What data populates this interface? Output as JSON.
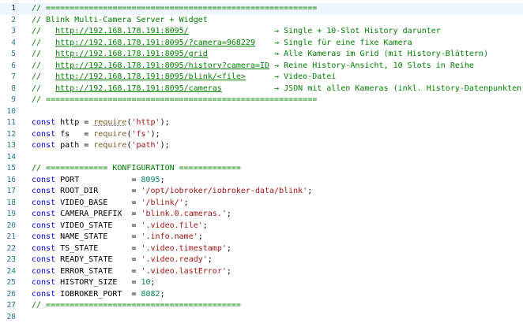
{
  "lines": [
    {
      "n": "1",
      "active": true,
      "tokens": [
        {
          "t": "// =========================================================",
          "c": "c"
        }
      ]
    },
    {
      "n": "2",
      "tokens": [
        {
          "t": "// Blink Multi-Camera Server + Widget",
          "c": "c"
        }
      ]
    },
    {
      "n": "3",
      "tokens": [
        {
          "t": "//   ",
          "c": "c"
        },
        {
          "t": "http://192.168.178.191:8095/",
          "c": "u"
        },
        {
          "t": "                  → Single + 10-Slot History darunter",
          "c": "c"
        }
      ]
    },
    {
      "n": "4",
      "tokens": [
        {
          "t": "//   ",
          "c": "c"
        },
        {
          "t": "http://192.168.178.191:8095/?camera=968229",
          "c": "u"
        },
        {
          "t": "    → Single für eine fixe Kamera",
          "c": "c"
        }
      ]
    },
    {
      "n": "5",
      "tokens": [
        {
          "t": "//   ",
          "c": "c"
        },
        {
          "t": "http://192.168.178.191:8095/grid",
          "c": "u"
        },
        {
          "t": "              → Alle Kameras im Grid (mit History-Blättern)",
          "c": "c"
        }
      ]
    },
    {
      "n": "6",
      "tokens": [
        {
          "t": "//   ",
          "c": "c"
        },
        {
          "t": "http://192.168.178.191:8095/history?camera=ID",
          "c": "u"
        },
        {
          "t": " → Reine History-Ansicht, 10 Slots in Reihe",
          "c": "c"
        }
      ]
    },
    {
      "n": "7",
      "tokens": [
        {
          "t": "//   ",
          "c": "c"
        },
        {
          "t": "http://192.168.178.191:8095/blink/<file>",
          "c": "u"
        },
        {
          "t": "      → Video-Datei",
          "c": "c"
        }
      ]
    },
    {
      "n": "8",
      "tokens": [
        {
          "t": "//   ",
          "c": "c"
        },
        {
          "t": "http://192.168.178.191:8095/cameras",
          "c": "u"
        },
        {
          "t": "           → JSON mit allen Kameras (inkl. History-Datenpunkten)",
          "c": "c"
        }
      ]
    },
    {
      "n": "9",
      "tokens": [
        {
          "t": "// =========================================================",
          "c": "c"
        }
      ]
    },
    {
      "n": "10",
      "tokens": []
    },
    {
      "n": "11",
      "tokens": [
        {
          "t": "const",
          "c": "k"
        },
        {
          "t": " http = ",
          "c": "t"
        },
        {
          "t": "require",
          "c": "f rq"
        },
        {
          "t": "(",
          "c": "t"
        },
        {
          "t": "'http'",
          "c": "s"
        },
        {
          "t": ");",
          "c": "t"
        }
      ]
    },
    {
      "n": "12",
      "tokens": [
        {
          "t": "const",
          "c": "k"
        },
        {
          "t": " fs   = ",
          "c": "t"
        },
        {
          "t": "require",
          "c": "f"
        },
        {
          "t": "(",
          "c": "t"
        },
        {
          "t": "'fs'",
          "c": "s"
        },
        {
          "t": ");",
          "c": "t"
        }
      ]
    },
    {
      "n": "13",
      "tokens": [
        {
          "t": "const",
          "c": "k"
        },
        {
          "t": " path = ",
          "c": "t"
        },
        {
          "t": "require",
          "c": "f"
        },
        {
          "t": "(",
          "c": "t"
        },
        {
          "t": "'path'",
          "c": "s"
        },
        {
          "t": ");",
          "c": "t"
        }
      ]
    },
    {
      "n": "14",
      "tokens": []
    },
    {
      "n": "15",
      "tokens": [
        {
          "t": "// ============= KONFIGURATION =============",
          "c": "c"
        }
      ]
    },
    {
      "n": "16",
      "tokens": [
        {
          "t": "const",
          "c": "k"
        },
        {
          "t": " PORT           = ",
          "c": "t"
        },
        {
          "t": "8095",
          "c": "n"
        },
        {
          "t": ";",
          "c": "t"
        }
      ]
    },
    {
      "n": "17",
      "tokens": [
        {
          "t": "const",
          "c": "k"
        },
        {
          "t": " ROOT_DIR       = ",
          "c": "t"
        },
        {
          "t": "'/opt/iobroker/iobroker-data/blink'",
          "c": "s"
        },
        {
          "t": ";",
          "c": "t"
        }
      ]
    },
    {
      "n": "18",
      "tokens": [
        {
          "t": "const",
          "c": "k"
        },
        {
          "t": " VIDEO_BASE     = ",
          "c": "t"
        },
        {
          "t": "'/blink/'",
          "c": "s"
        },
        {
          "t": ";",
          "c": "t"
        }
      ]
    },
    {
      "n": "19",
      "tokens": [
        {
          "t": "const",
          "c": "k"
        },
        {
          "t": " CAMERA_PREFIX  = ",
          "c": "t"
        },
        {
          "t": "'blink.0.cameras.'",
          "c": "s"
        },
        {
          "t": ";",
          "c": "t"
        }
      ]
    },
    {
      "n": "20",
      "tokens": [
        {
          "t": "const",
          "c": "k"
        },
        {
          "t": " VIDEO_STATE    = ",
          "c": "t"
        },
        {
          "t": "'.video.file'",
          "c": "s"
        },
        {
          "t": ";",
          "c": "t"
        }
      ]
    },
    {
      "n": "21",
      "tokens": [
        {
          "t": "const",
          "c": "k"
        },
        {
          "t": " NAME_STATE     = ",
          "c": "t"
        },
        {
          "t": "'.info.name'",
          "c": "s"
        },
        {
          "t": ";",
          "c": "t"
        }
      ]
    },
    {
      "n": "22",
      "tokens": [
        {
          "t": "const",
          "c": "k"
        },
        {
          "t": " TS_STATE       = ",
          "c": "t"
        },
        {
          "t": "'.video.timestamp'",
          "c": "s"
        },
        {
          "t": ";",
          "c": "t"
        }
      ]
    },
    {
      "n": "23",
      "tokens": [
        {
          "t": "const",
          "c": "k"
        },
        {
          "t": " READY_STATE    = ",
          "c": "t"
        },
        {
          "t": "'.video.ready'",
          "c": "s"
        },
        {
          "t": ";",
          "c": "t"
        }
      ]
    },
    {
      "n": "24",
      "tokens": [
        {
          "t": "const",
          "c": "k"
        },
        {
          "t": " ERROR_STATE    = ",
          "c": "t"
        },
        {
          "t": "'.video.lastError'",
          "c": "s"
        },
        {
          "t": ";",
          "c": "t"
        }
      ]
    },
    {
      "n": "25",
      "tokens": [
        {
          "t": "const",
          "c": "k"
        },
        {
          "t": " HISTORY_SIZE   = ",
          "c": "t"
        },
        {
          "t": "10",
          "c": "n"
        },
        {
          "t": ";",
          "c": "t"
        }
      ]
    },
    {
      "n": "26",
      "tokens": [
        {
          "t": "const",
          "c": "k"
        },
        {
          "t": " IOBROKER_PORT  = ",
          "c": "t"
        },
        {
          "t": "8082",
          "c": "n"
        },
        {
          "t": ";",
          "c": "t"
        }
      ]
    },
    {
      "n": "27",
      "tokens": [
        {
          "t": "// =========================================",
          "c": "c"
        }
      ]
    },
    {
      "n": "28",
      "tokens": []
    }
  ]
}
